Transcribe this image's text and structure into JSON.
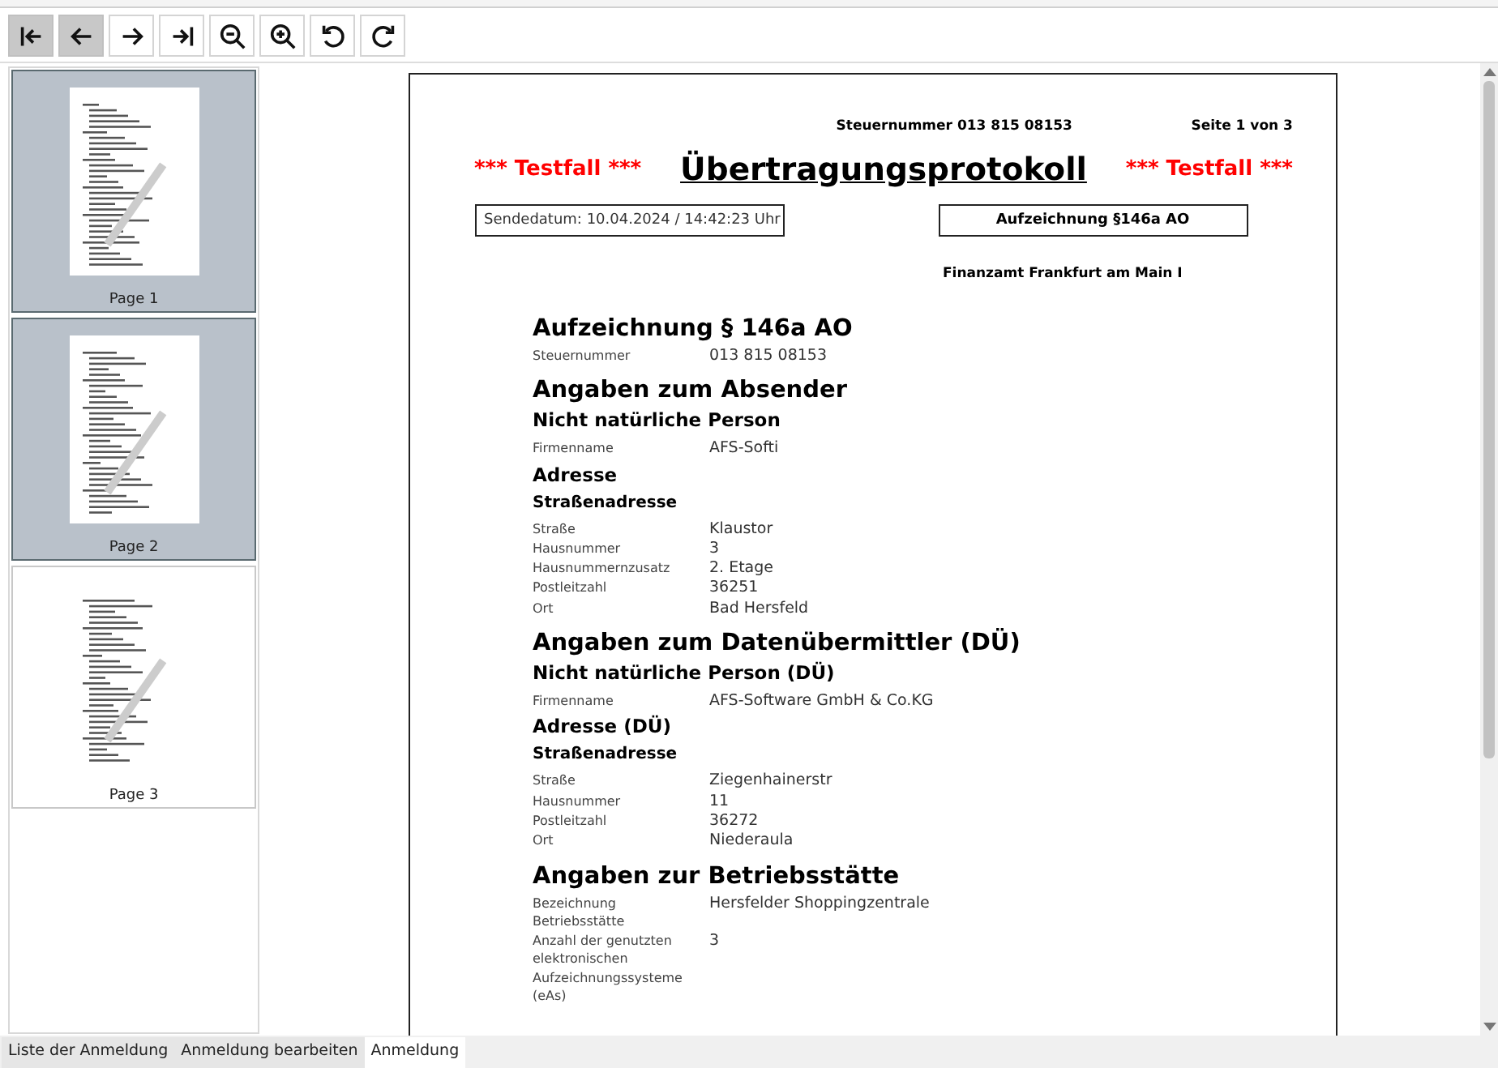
{
  "toolbar": [
    {
      "kind": "first",
      "disabled": true
    },
    {
      "kind": "prev",
      "disabled": true
    },
    {
      "kind": "next",
      "disabled": false
    },
    {
      "kind": "last",
      "disabled": false
    },
    {
      "kind": "zoom-out",
      "disabled": false
    },
    {
      "kind": "zoom-in",
      "disabled": false
    },
    {
      "kind": "rotate-left",
      "disabled": false
    },
    {
      "kind": "rotate-right",
      "disabled": false
    }
  ],
  "thumbnails": [
    {
      "label": "Page 1",
      "selected": true
    },
    {
      "label": "Page 2",
      "selected": true
    },
    {
      "label": "Page 3",
      "selected": false
    }
  ],
  "document": {
    "tax_number_header": "Steuernummer 013 815 08153",
    "page_indicator": "Seite 1 von 3",
    "test_left": "*** Testfall ***",
    "title": "Übertragungsprotokoll",
    "test_right": "*** Testfall ***",
    "send_date": "Sendedatum: 10.04.2024 / 14:42:23 Uhr",
    "record_type": "Aufzeichnung §146a AO",
    "tax_office": "Finanzamt Frankfurt am Main I",
    "content": [
      {
        "kind": "h1",
        "text": "Aufzeichnung § 146a AO"
      },
      {
        "kind": "field",
        "label": "Steuernummer",
        "value": "013 815 08153"
      },
      {
        "kind": "h1",
        "text": "Angaben zum Absender"
      },
      {
        "kind": "h2",
        "text": "Nicht natürliche Person"
      },
      {
        "kind": "field",
        "label": "Firmenname",
        "value": "AFS-Softi"
      },
      {
        "kind": "h2",
        "text": "Adresse"
      },
      {
        "kind": "h3",
        "text": "Straßenadresse"
      },
      {
        "kind": "field",
        "label": "Straße",
        "value": "Klaustor"
      },
      {
        "kind": "field",
        "label": "Hausnummer",
        "value": "3"
      },
      {
        "kind": "field",
        "label": "Hausnummernzusatz",
        "value": "2. Etage"
      },
      {
        "kind": "field",
        "label": "Postleitzahl",
        "value": "36251"
      },
      {
        "kind": "field",
        "label": "Ort",
        "value": "Bad Hersfeld"
      },
      {
        "kind": "h1",
        "text": "Angaben zum Datenübermittler (DÜ)"
      },
      {
        "kind": "h2",
        "text": "Nicht natürliche Person (DÜ)"
      },
      {
        "kind": "field",
        "label": "Firmenname",
        "value": "AFS-Software GmbH & Co.KG"
      },
      {
        "kind": "h2",
        "text": "Adresse (DÜ)"
      },
      {
        "kind": "h3",
        "text": "Straßenadresse"
      },
      {
        "kind": "field",
        "label": "Straße",
        "value": "Ziegenhainerstr"
      },
      {
        "kind": "field",
        "label": "Hausnummer",
        "value": "11"
      },
      {
        "kind": "field",
        "label": "Postleitzahl",
        "value": "36272"
      },
      {
        "kind": "field",
        "label": "Ort",
        "value": "Niederaula"
      },
      {
        "kind": "h1",
        "text": "Angaben zur Betriebsstätte"
      },
      {
        "kind": "field",
        "label": "Bezeichnung Betriebsstätte",
        "value": "Hersfelder Shoppingzentrale"
      },
      {
        "kind": "field",
        "label": "Anzahl der genutzten elektronischen Aufzeichnungssysteme (eAs)",
        "value": "3"
      }
    ]
  },
  "bottom_tabs": [
    {
      "label": "Liste der Anmeldung",
      "selected": false
    },
    {
      "label": "Anmeldung bearbeiten",
      "selected": false
    },
    {
      "label": "Anmeldung",
      "selected": true
    }
  ]
}
